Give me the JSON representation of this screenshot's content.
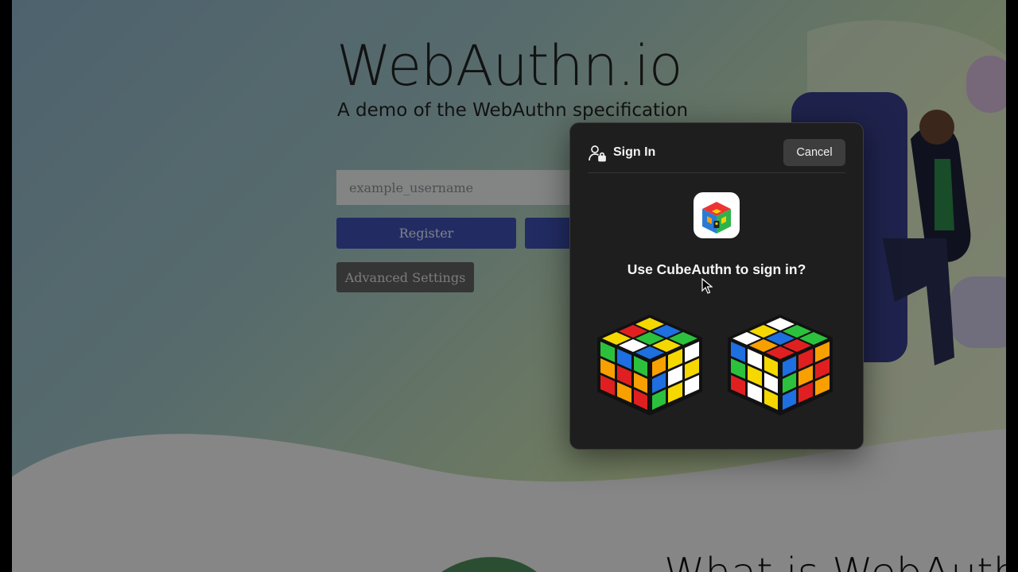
{
  "page": {
    "title": "WebAuthn.io",
    "subtitle": "A demo of the WebAuthn specification",
    "username_placeholder": "example_username",
    "register_label": "Register",
    "authenticate_label": "",
    "advanced_label": "Advanced Settings",
    "bottom_heading": "What is WebAuthn?"
  },
  "dialog": {
    "header_icon": "person-lock-icon",
    "title": "Sign In",
    "cancel_label": "Cancel",
    "app_icon": "cube-authn-app-icon",
    "prompt": "Use CubeAuthn to sign in?",
    "cube_icon": "rubiks-cube-icon"
  },
  "colors": {
    "dialog_bg": "#1e1e1e",
    "primary_button": "#3f51b5",
    "secondary_button": "#616161",
    "cancel_button": "#3d3d3d"
  }
}
